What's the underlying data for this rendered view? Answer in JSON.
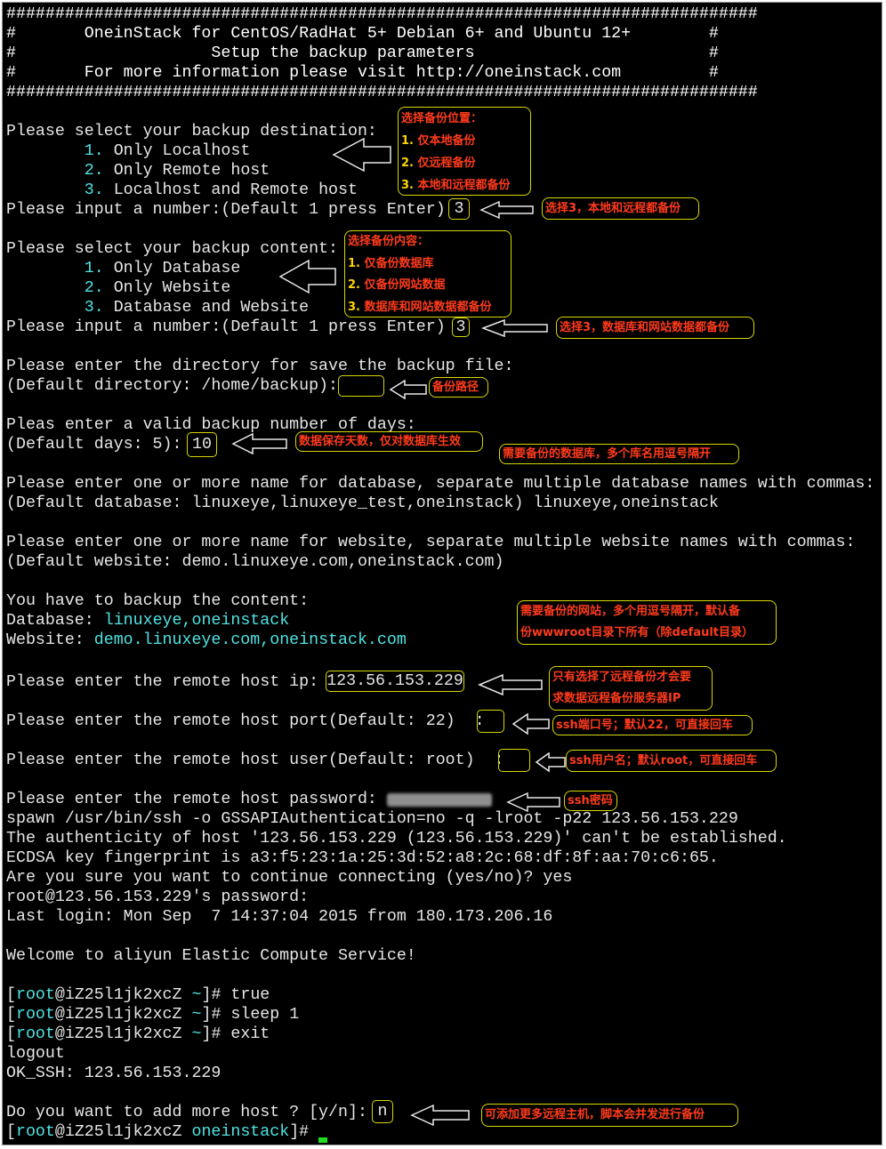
{
  "header": {
    "border": "#############################################################################",
    "line1": "#       OneinStack for CentOS/RadHat 5+ Debian 6+ and Ubuntu 12+        #",
    "line2": "#                    Setup the backup parameters                        #",
    "line3": "#       For more information please visit http://oneinstack.com         #"
  },
  "destination": {
    "prompt": "Please select your backup destination:",
    "options": [
      {
        "num": "1.",
        "label": "Only Localhost"
      },
      {
        "num": "2.",
        "label": "Only Remote host"
      },
      {
        "num": "3.",
        "label": "Localhost and Remote host"
      }
    ],
    "input_prompt": "Please input a number:(Default 1 press Enter)",
    "input_value": "3"
  },
  "content": {
    "prompt": "Please select your backup content:",
    "options": [
      {
        "num": "1.",
        "label": "Only Database"
      },
      {
        "num": "2.",
        "label": "Only Website"
      },
      {
        "num": "3.",
        "label": "Database and Website"
      }
    ],
    "input_prompt": "Please input a number:(Default 1 press Enter)",
    "input_value": "3"
  },
  "directory": {
    "prompt": "Please enter the directory for save the backup file:",
    "default": "(Default directory: /home/backup):",
    "value": ""
  },
  "days": {
    "prompt": "Pleas enter a valid backup number of days:",
    "default": "(Default days: 5):",
    "value": "10"
  },
  "database": {
    "prompt": "Please enter one or more name for database, separate multiple database names with commas:",
    "default": "(Default database: linuxeye,linuxeye_test,oneinstack) linuxeye,oneinstack"
  },
  "website": {
    "prompt": "Please enter one or more name for website, separate multiple website names with commas:",
    "default": "(Default website: demo.linuxeye.com,oneinstack.com)"
  },
  "summary": {
    "title": "You have to backup the content:",
    "db_label": "Database:",
    "db_value": "linuxeye,oneinstack",
    "web_label": "Website:",
    "web_value": "demo.linuxeye.com,oneinstack.com"
  },
  "remote": {
    "ip_prompt": "Please enter the remote host ip:",
    "ip_value": "123.56.153.229",
    "port_prompt": "Please enter the remote host port(Default: 22)  :",
    "user_prompt": "Please enter the remote host user(Default: root)  :",
    "password_prompt": "Please enter the remote host password:"
  },
  "ssh": {
    "spawn": "spawn /usr/bin/ssh -o GSSAPIAuthentication=no -q -lroot -p22 123.56.153.229",
    "auth": "The authenticity of host '123.56.153.229 (123.56.153.229)' can't be established.",
    "fingerprint": "ECDSA key fingerprint is a3:f5:23:1a:25:3d:52:a8:2c:68:df:8f:aa:70:c6:65.",
    "continue": "Are you sure you want to continue connecting (yes/no)? yes",
    "password": "root@123.56.153.229's password:",
    "last_login": "Last login: Mon Sep  7 14:37:04 2015 from 180.173.206.16",
    "welcome": "Welcome to aliyun Elastic Compute Service!",
    "user": "root",
    "host": "@iZ25l1jk2xcZ",
    "home": "~",
    "cmd1": "true",
    "cmd2": "sleep 1",
    "cmd3": "exit",
    "logout": "logout",
    "ok": "OK_SSH: 123.56.153.229"
  },
  "more_host": {
    "prompt": "Do you want to add more host ? [y/n]:",
    "value": "n"
  },
  "final_prompt": {
    "user": "root",
    "host": "@iZ25l1jk2xcZ",
    "dir": "oneinstack"
  },
  "annotations": {
    "dest_title": "选择备份位置：",
    "dest_1_num": "1.",
    "dest_1": " 仅本地备份",
    "dest_2_num": "2.",
    "dest_2": " 仅远程备份",
    "dest_3_num": "3.",
    "dest_3": " 本地和远程都备份",
    "dest_choice": "选择3，本地和远程都备份",
    "content_title": "选择备份内容：",
    "content_1_num": "1.",
    "content_1": " 仅备份数据库",
    "content_2_num": "2.",
    "content_2": " 仅备份网站数据",
    "content_3_num": "3.",
    "content_3": " 数据库和网站数据都备份",
    "content_choice": "选择3，数据库和网站数据都备份",
    "path": "备份路径",
    "days": "数据保存天数，仅对数据库生效",
    "databases": "需要备份的数据库，多个库名用逗号隔开",
    "websites_1": "需要备份的网站，多个用逗号隔开，默认备",
    "websites_2": "份wwwroot目录下所有（除default目录）",
    "remote_1": "只有选择了远程备份才会要",
    "remote_2": "求数据远程备份服务器IP",
    "port": "ssh端口号；默认22，可直接回车",
    "user": "ssh用户名；默认root，可直接回车",
    "password": "ssh密码",
    "more": "可添加更多远程主机，脚本会并发进行备份"
  },
  "colors": {
    "terminal_bg": "#000000",
    "text": "#e6e6e6",
    "cyan": "#4fe3e3",
    "green": "#22dd22",
    "annotation_red": "#ff3b1c",
    "annotation_yellow": "#ffd400",
    "box_border": "#d8d800"
  }
}
